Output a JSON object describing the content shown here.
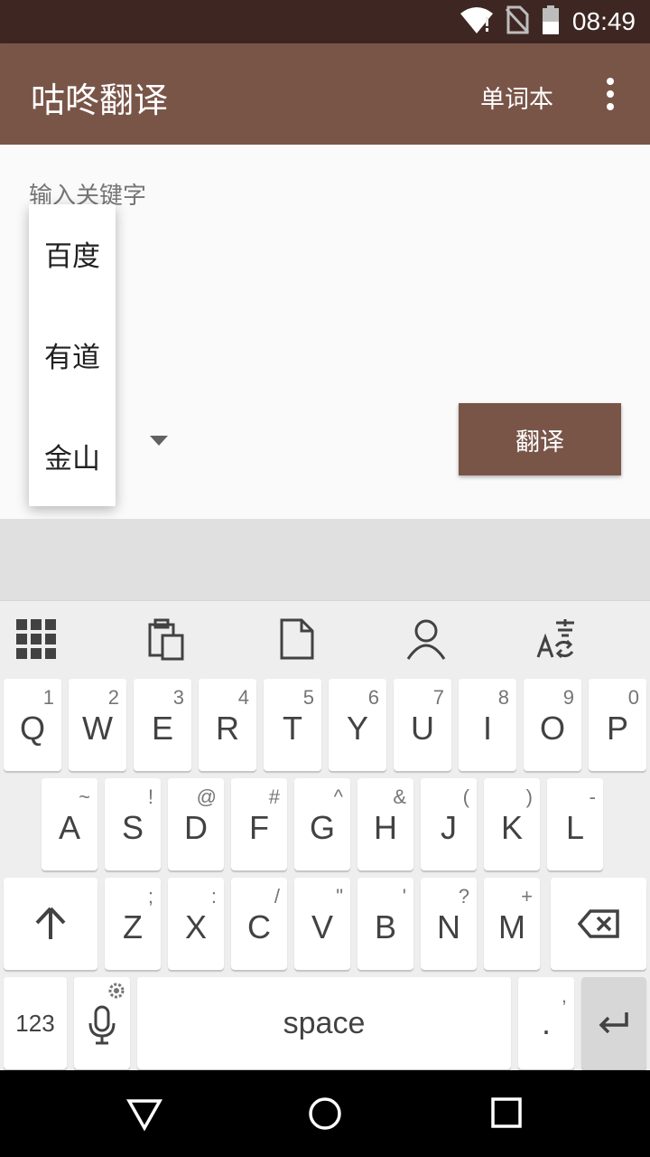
{
  "status_bar": {
    "time": "08:49"
  },
  "app_bar": {
    "title": "咕咚翻译",
    "vocab_label": "单词本"
  },
  "content": {
    "keyword_hint": "输入关键字",
    "translate_label": "翻译",
    "dropdown_options": [
      "百度",
      "有道",
      "金山"
    ]
  },
  "keyboard": {
    "row1": [
      {
        "key": "Q",
        "hint": "1"
      },
      {
        "key": "W",
        "hint": "2"
      },
      {
        "key": "E",
        "hint": "3"
      },
      {
        "key": "R",
        "hint": "4"
      },
      {
        "key": "T",
        "hint": "5"
      },
      {
        "key": "Y",
        "hint": "6"
      },
      {
        "key": "U",
        "hint": "7"
      },
      {
        "key": "I",
        "hint": "8"
      },
      {
        "key": "O",
        "hint": "9"
      },
      {
        "key": "P",
        "hint": "0"
      }
    ],
    "row2": [
      {
        "key": "A",
        "hint": "~"
      },
      {
        "key": "S",
        "hint": "!"
      },
      {
        "key": "D",
        "hint": "@"
      },
      {
        "key": "F",
        "hint": "#"
      },
      {
        "key": "G",
        "hint": "^"
      },
      {
        "key": "H",
        "hint": "&"
      },
      {
        "key": "J",
        "hint": "("
      },
      {
        "key": "K",
        "hint": ")"
      },
      {
        "key": "L",
        "hint": "-"
      }
    ],
    "row3": [
      {
        "key": "Z",
        "hint": ";"
      },
      {
        "key": "X",
        "hint": ":"
      },
      {
        "key": "C",
        "hint": "/"
      },
      {
        "key": "V",
        "hint": "\""
      },
      {
        "key": "B",
        "hint": "'"
      },
      {
        "key": "N",
        "hint": "?"
      },
      {
        "key": "M",
        "hint": "+"
      }
    ],
    "numbers_label": "123",
    "space_label": "space",
    "period_label": ".",
    "period_hint": ","
  },
  "colors": {
    "status_bar": "#3e2723",
    "primary": "#795548",
    "keyboard_bg": "#eeeeee"
  }
}
